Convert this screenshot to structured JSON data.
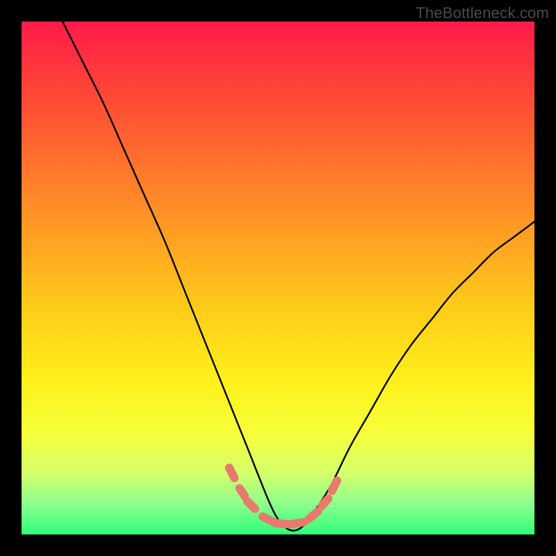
{
  "watermark": "TheBottleneck.com",
  "colors": {
    "marker_stroke": "#e87a6d",
    "curve_stroke": "#000000",
    "gradient_top": "#ff1a4b",
    "gradient_bottom": "#2eff7a",
    "frame": "#000000"
  },
  "chart_data": {
    "type": "line",
    "title": "",
    "xlabel": "",
    "ylabel": "",
    "xlim": [
      0,
      100
    ],
    "ylim": [
      0,
      100
    ],
    "grid": false,
    "legend": false,
    "annotations": [
      "TheBottleneck.com"
    ],
    "series": [
      {
        "name": "bottleneck-curve",
        "x": [
          8,
          12,
          16,
          20,
          24,
          28,
          32,
          36,
          40,
          44,
          48,
          50,
          52,
          54,
          56,
          60,
          64,
          68,
          72,
          76,
          80,
          84,
          88,
          92,
          96,
          100
        ],
        "y": [
          100,
          92,
          84,
          75,
          66,
          57,
          47,
          37,
          27,
          17,
          7,
          3,
          1,
          1,
          3,
          9,
          17,
          24,
          31,
          37,
          42,
          47,
          51,
          55,
          58,
          61
        ]
      }
    ],
    "markers": {
      "type": "dash-segments",
      "color": "#e87a6d",
      "segments": [
        {
          "x0": 40.5,
          "y0": 13.0,
          "x1": 41.5,
          "y1": 11.0
        },
        {
          "x0": 42.5,
          "y0": 9.0,
          "x1": 43.5,
          "y1": 7.5
        },
        {
          "x0": 44.0,
          "y0": 6.5,
          "x1": 45.5,
          "y1": 5.0
        },
        {
          "x0": 47.0,
          "y0": 3.5,
          "x1": 49.0,
          "y1": 2.5
        },
        {
          "x0": 49.5,
          "y0": 2.2,
          "x1": 52.0,
          "y1": 2.0
        },
        {
          "x0": 52.5,
          "y0": 2.0,
          "x1": 55.0,
          "y1": 2.4
        },
        {
          "x0": 56.0,
          "y0": 3.0,
          "x1": 57.8,
          "y1": 4.5
        },
        {
          "x0": 58.5,
          "y0": 5.5,
          "x1": 59.8,
          "y1": 7.0
        },
        {
          "x0": 60.5,
          "y0": 8.5,
          "x1": 61.5,
          "y1": 10.5
        }
      ]
    }
  }
}
